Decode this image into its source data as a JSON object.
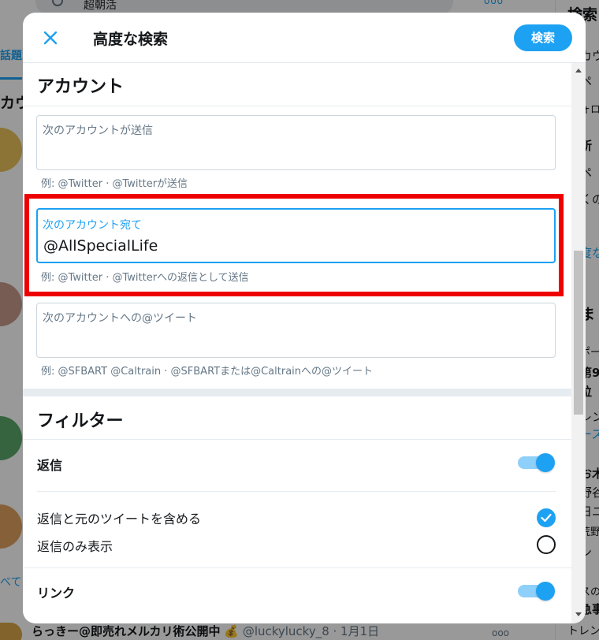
{
  "background": {
    "search_query": "超朝活",
    "more_dots": "ooo",
    "right_title": "検索",
    "right_lines": [
      "カウ",
      "ペ",
      "ォロ",
      "所",
      "ペ",
      "くの",
      "度な",
      "ま",
      "ポー",
      "第9",
      "位",
      "レン",
      "ース",
      "お木",
      "野谷",
      "日ユ",
      "荒野",
      "ン",
      "スの",
      "急事",
      "トレン"
    ],
    "left_tab": "話題",
    "left_heading": "カウ",
    "left_more": "べてる",
    "bottom_tweet": {
      "name": "らっきー@即売れメルカリ術公開中",
      "emoji": "💰",
      "handle": "@luckylucky_8 · 1月1日",
      "dots": "ooo"
    }
  },
  "modal": {
    "title": "高度な検索",
    "search_button": "検索",
    "accounts": {
      "heading": "アカウント",
      "from": {
        "label": "次のアカウントが送信",
        "value": "",
        "hint": "例: @Twitter · @Twitterが送信"
      },
      "to": {
        "label": "次のアカウント宛て",
        "value": "@AllSpecialLife",
        "hint": "例: @Twitter · @Twitterへの返信として送信"
      },
      "mentions": {
        "label": "次のアカウントへの@ツイート",
        "value": "",
        "hint": "例: @SFBART @Caltrain · @SFBARTまたは@Caltrainへの@ツイート"
      }
    },
    "filters": {
      "heading": "フィルター",
      "replies": {
        "label": "返信",
        "enabled": true
      },
      "include_replies": {
        "label": "返信と元のツイートを含める",
        "checked": true
      },
      "only_replies": {
        "label": "返信のみ表示",
        "checked": false
      },
      "links": {
        "label": "リンク",
        "enabled": true
      }
    }
  },
  "colors": {
    "accent": "#1da1f2",
    "highlight": "#ee0000"
  }
}
